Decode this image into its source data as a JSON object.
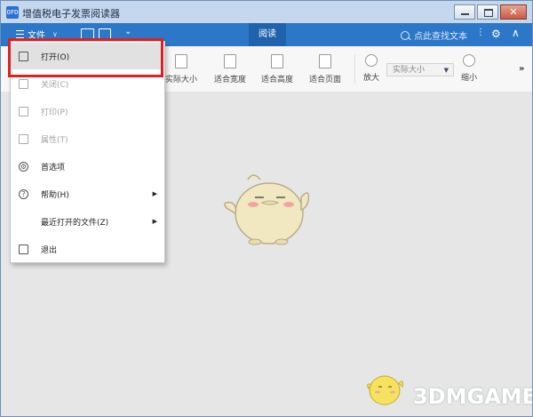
{
  "window": {
    "title": "增值税电子发票阅读器",
    "app_icon_text": "OFD",
    "close_glyph": "✕"
  },
  "appbar": {
    "menu_label": "文件",
    "caret": "∨",
    "more": "⌄",
    "tab_read": "阅读",
    "search_placeholder": "点此查找文本",
    "kebab": "⋮",
    "gear": "⚙",
    "collapse": "∧"
  },
  "toolbar": {
    "actual_size": "实际大小",
    "fit_width": "适合宽度",
    "fit_height": "适合高度",
    "fit_page": "适合页面",
    "zoom_in": "放大",
    "zoom_select": "实际大小",
    "zoom_out": "缩小",
    "overflow": "»"
  },
  "file_menu": {
    "items": [
      {
        "label": "打开(O)",
        "icon": "folder-open-icon",
        "enabled": true
      },
      {
        "label": "关闭(C)",
        "icon": "close-doc-icon",
        "enabled": false
      },
      {
        "label": "打印(P)",
        "icon": "printer-icon",
        "enabled": false
      },
      {
        "label": "属性(T)",
        "icon": "properties-icon",
        "enabled": false
      },
      {
        "label": "首选项",
        "icon": "gear-icon",
        "enabled": true
      },
      {
        "label": "帮助(H)",
        "icon": "help-icon",
        "enabled": true,
        "submenu": true
      },
      {
        "label": "最近打开的文件(Z)",
        "icon": "",
        "enabled": true,
        "submenu": true
      },
      {
        "label": "退出",
        "icon": "exit-icon",
        "enabled": true
      }
    ],
    "submenu_arrow": "▶"
  },
  "watermark": {
    "text": "3DMGAME"
  },
  "colors": {
    "appbar": "#2c77c8",
    "tab_active": "#1f63ad",
    "highlight_box": "#e02020",
    "canvas": "#e6e6e6"
  }
}
